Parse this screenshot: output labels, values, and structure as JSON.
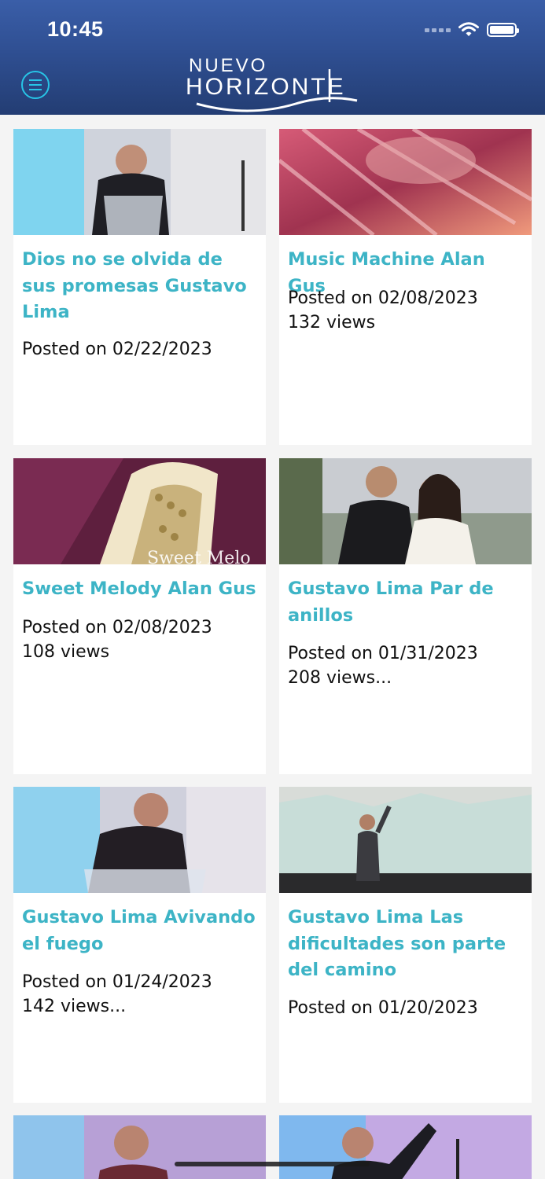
{
  "status_bar": {
    "time": "10:45"
  },
  "header": {
    "logo_line1": "NUEVO",
    "logo_line2": "HORIZONTE"
  },
  "colors": {
    "header_bg": "#2f4f92",
    "accent": "#27c4e6",
    "title_color": "#3db4c6",
    "card_bg": "#ffffff",
    "page_bg": "#f4f4f4"
  },
  "posts": [
    {
      "title": "Dios no se olvida de sus promesas Gustavo Lima",
      "posted": "Posted on 02/22/2023",
      "views": ""
    },
    {
      "title": "Music Machine Alan Gus",
      "posted": "Posted on 02/08/2023",
      "views": "132 views"
    },
    {
      "title": "Sweet Melody Alan Gus",
      "posted": "Posted on 02/08/2023",
      "views": "108 views",
      "thumb_caption": "Sweet Melo"
    },
    {
      "title": "Gustavo Lima Par de anillos",
      "posted": "Posted on 01/31/2023",
      "views": "208 views..."
    },
    {
      "title": "Gustavo Lima Avivando el fuego",
      "posted": "Posted on 01/24/2023",
      "views": "142 views..."
    },
    {
      "title": "Gustavo Lima Las dificultades son parte del camino",
      "posted": "Posted on 01/20/2023",
      "views": ""
    }
  ]
}
